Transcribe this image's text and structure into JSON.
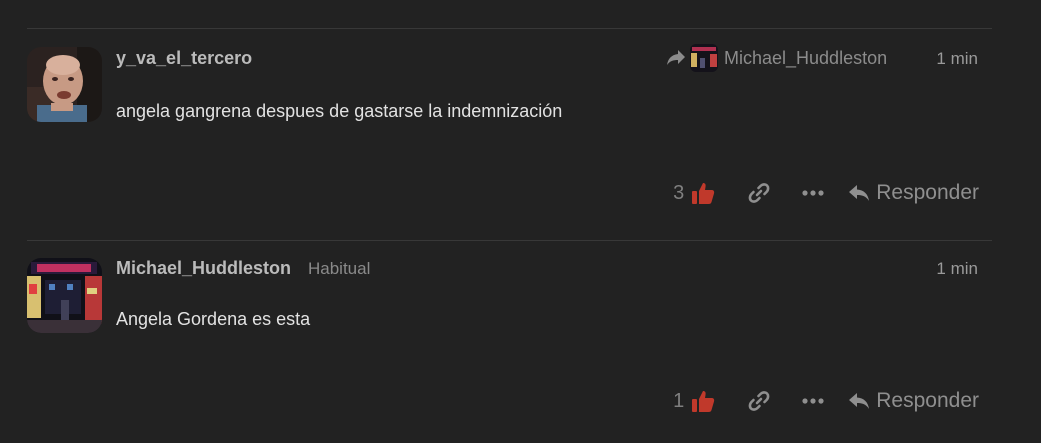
{
  "posts": [
    {
      "username": "y_va_el_tercero",
      "user_title": "",
      "reply_to": {
        "username": "Michael_Huddleston",
        "icon": "share-arrow-icon"
      },
      "timestamp": "1 min",
      "body": "angela gangrena despues de gastarse la indemnización",
      "likes": "3",
      "reply_label": "Responder"
    },
    {
      "username": "Michael_Huddleston",
      "user_title": "Habitual",
      "timestamp": "1 min",
      "body": "Angela Gordena es esta",
      "likes": "1",
      "reply_label": "Responder"
    }
  ],
  "icons": {
    "like": "thumbs-up-icon",
    "link": "link-icon",
    "more": "ellipsis-icon",
    "reply": "reply-arrow-icon"
  },
  "colors": {
    "background": "#222222",
    "like_accent": "#c0392b",
    "muted_text": "#8f8f8f"
  }
}
